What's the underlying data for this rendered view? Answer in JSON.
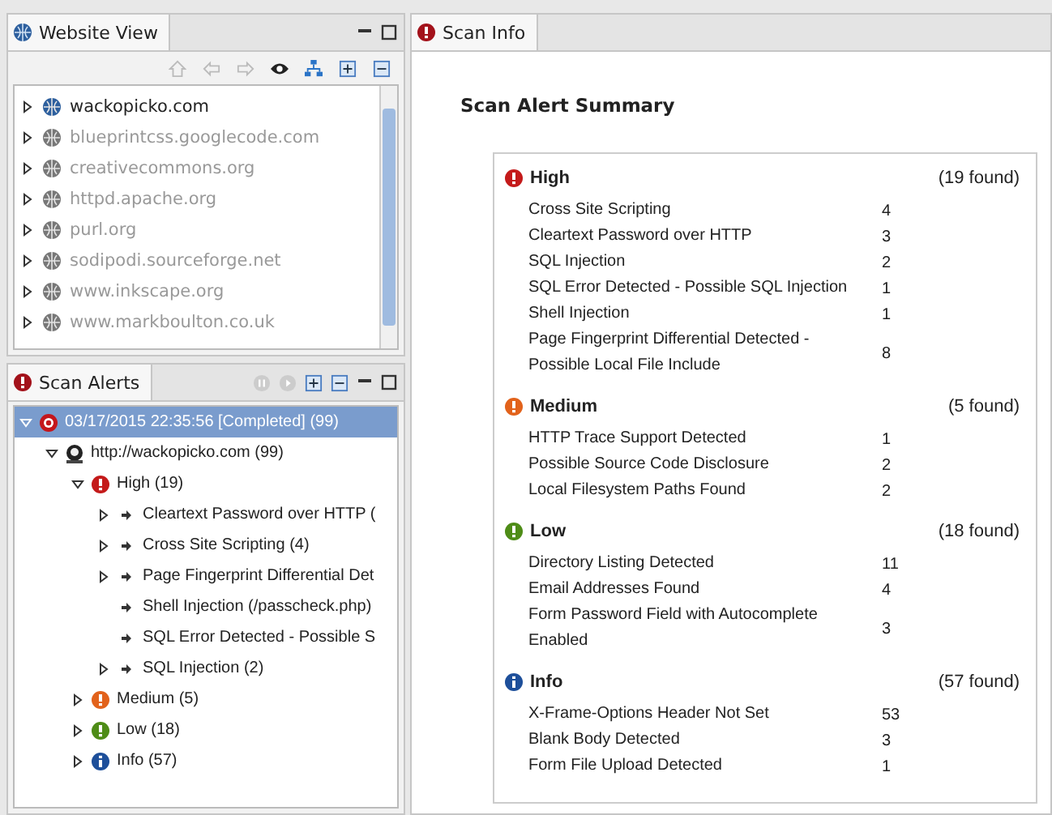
{
  "website_view": {
    "tab": "Website View",
    "sites": [
      {
        "label": "wackopicko.com",
        "active": true
      },
      {
        "label": "blueprintcss.googlecode.com",
        "active": false
      },
      {
        "label": "creativecommons.org",
        "active": false
      },
      {
        "label": "httpd.apache.org",
        "active": false
      },
      {
        "label": "purl.org",
        "active": false
      },
      {
        "label": "sodipodi.sourceforge.net",
        "active": false
      },
      {
        "label": "www.inkscape.org",
        "active": false
      },
      {
        "label": "www.markboulton.co.uk",
        "active": false
      }
    ]
  },
  "scan_alerts": {
    "tab": "Scan Alerts",
    "tree": [
      {
        "label": "03/17/2015 22:35:56 [Completed]  (99)",
        "kind": "scan",
        "expanded": true,
        "selected": true,
        "children": [
          {
            "label": "http://wackopicko.com (99)",
            "kind": "host",
            "expanded": true,
            "selected": false,
            "children": [
              {
                "label": "High (19)",
                "kind": "high",
                "expanded": true,
                "selected": false,
                "children": [
                  {
                    "label": "Cleartext Password over HTTP (",
                    "kind": "alert",
                    "expanded": false,
                    "selected": false
                  },
                  {
                    "label": "Cross Site Scripting (4)",
                    "kind": "alert",
                    "expanded": false,
                    "selected": false
                  },
                  {
                    "label": "Page Fingerprint Differential Det",
                    "kind": "alert",
                    "expanded": false,
                    "selected": false
                  },
                  {
                    "label": "Shell Injection (/passcheck.php)",
                    "kind": "alert",
                    "selected": false
                  },
                  {
                    "label": "SQL Error Detected - Possible S",
                    "kind": "alert",
                    "selected": false
                  },
                  {
                    "label": "SQL Injection (2)",
                    "kind": "alert",
                    "expanded": false,
                    "selected": false
                  }
                ]
              },
              {
                "label": "Medium (5)",
                "kind": "medium",
                "expanded": false,
                "selected": false
              },
              {
                "label": "Low (18)",
                "kind": "low",
                "expanded": false,
                "selected": false
              },
              {
                "label": "Info (57)",
                "kind": "info",
                "expanded": false,
                "selected": false
              }
            ]
          }
        ]
      }
    ]
  },
  "scan_info": {
    "tab": "Scan Info",
    "heading": "Scan Alert Summary",
    "groups": [
      {
        "kind": "high",
        "name": "High",
        "found": "(19 found)",
        "alerts": [
          {
            "name": "Cross Site Scripting",
            "count": "4"
          },
          {
            "name": "Cleartext Password over HTTP",
            "count": "3"
          },
          {
            "name": "SQL Injection",
            "count": "2"
          },
          {
            "name": "SQL Error Detected - Possible SQL Injection",
            "count": "1"
          },
          {
            "name": "Shell Injection",
            "count": "1"
          },
          {
            "name": "Page Fingerprint Differential Detected - Possible Local File Include",
            "count": "8"
          }
        ]
      },
      {
        "kind": "medium",
        "name": "Medium",
        "found": "(5 found)",
        "alerts": [
          {
            "name": "HTTP Trace Support Detected",
            "count": "1"
          },
          {
            "name": "Possible Source Code Disclosure",
            "count": "2"
          },
          {
            "name": "Local Filesystem Paths Found",
            "count": "2"
          }
        ]
      },
      {
        "kind": "low",
        "name": "Low",
        "found": "(18 found)",
        "alerts": [
          {
            "name": "Directory Listing Detected",
            "count": "11"
          },
          {
            "name": "Email Addresses Found",
            "count": "4"
          },
          {
            "name": "Form Password Field with Autocomplete Enabled",
            "count": "3"
          }
        ]
      },
      {
        "kind": "info",
        "name": "Info",
        "found": "(57 found)",
        "alerts": [
          {
            "name": "X-Frame-Options Header Not Set",
            "count": "53"
          },
          {
            "name": "Blank Body Detected",
            "count": "3"
          },
          {
            "name": "Form File Upload Detected",
            "count": "1"
          }
        ]
      }
    ]
  }
}
